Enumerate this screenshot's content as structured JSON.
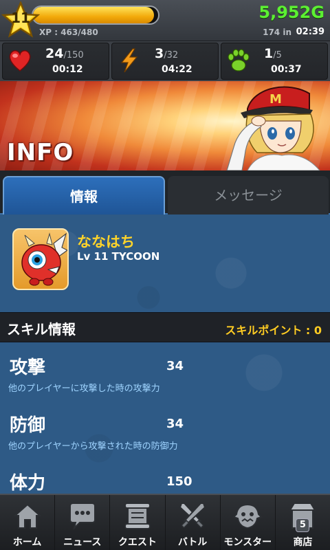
{
  "status": {
    "level": "11",
    "xp_text": "XP : 463/480",
    "xp_fraction": 0.965,
    "gold": "5,952G",
    "coins": "174 in",
    "coins_timer": "02:39"
  },
  "stats": [
    {
      "icon": "heart-icon",
      "value": "24",
      "max": "/150",
      "timer": "00:12"
    },
    {
      "icon": "lightning-icon",
      "value": "3",
      "max": "/32",
      "timer": "04:22"
    },
    {
      "icon": "paw-icon",
      "value": "1",
      "max": "/5",
      "timer": "00:37"
    }
  ],
  "banner": {
    "title": "INFO"
  },
  "tabs": [
    {
      "label": "情報",
      "active": true
    },
    {
      "label": "メッセージ",
      "active": false
    }
  ],
  "profile": {
    "name": "ななはち",
    "level_line": "Lv 11 TYCOON"
  },
  "skills_header": {
    "title": "スキル情報",
    "points": "スキルポイント : 0"
  },
  "skills": [
    {
      "name": "攻撃",
      "value": "34",
      "description": "他のプレイヤーに攻撃した時の攻撃力"
    },
    {
      "name": "防御",
      "value": "34",
      "description": "他のプレイヤーから攻撃された時の防御力"
    },
    {
      "name": "体力",
      "value": "150",
      "description": ""
    }
  ],
  "nav": [
    {
      "label": "ホーム",
      "icon": "home-icon"
    },
    {
      "label": "ニュース",
      "icon": "speech-bubble-icon"
    },
    {
      "label": "クエスト",
      "icon": "scroll-icon"
    },
    {
      "label": "バトル",
      "icon": "crossed-swords-icon"
    },
    {
      "label": "モンスター",
      "icon": "monster-head-icon"
    },
    {
      "label": "商店",
      "icon": "shop-icon",
      "badge": "5"
    }
  ],
  "colors": {
    "gold_text": "#5cf032",
    "name_text": "#ffd42a",
    "skill_points_text": "#ffcc22",
    "panel_blue": "#2e5a86",
    "tab_active": "#2d6fbb",
    "desc_text": "#9fd4ff"
  }
}
